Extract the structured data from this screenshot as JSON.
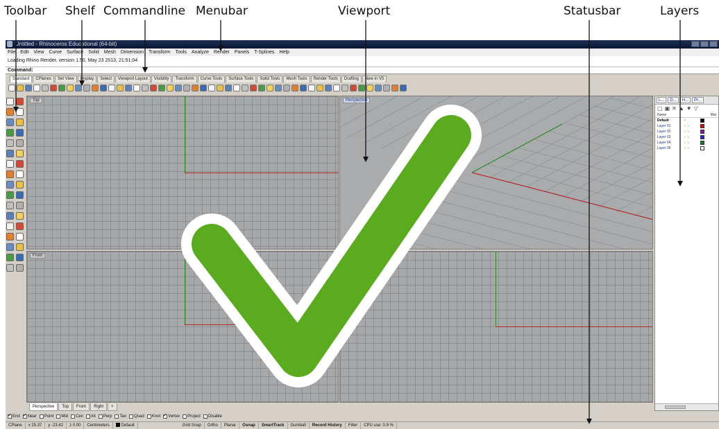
{
  "callouts": {
    "toolbar": "Toolbar",
    "shelf": "Shelf",
    "commandline": "Commandline",
    "menubar": "Menubar",
    "viewport": "Viewport",
    "statusbar": "Statusbar",
    "layers": "Layers"
  },
  "app": {
    "title": "Untitled - Rhinoceros Educational (64-bit)",
    "menu": [
      "File",
      "Edit",
      "View",
      "Curve",
      "Surface",
      "Solid",
      "Mesh",
      "Dimension",
      "Transform",
      "Tools",
      "Analyze",
      "Render",
      "Panels",
      "T-Splines",
      "Help"
    ],
    "history_line": "Loading Rhino Render, version 1.50, May 23 2013, 21:51:04",
    "command_prompt": "Command:",
    "toolbar_tabs": [
      "Standard",
      "CPlanes",
      "Set View",
      "Display",
      "Select",
      "Viewport Layout",
      "Visibility",
      "Transform",
      "Curve Tools",
      "Surface Tools",
      "Solid Tools",
      "Mesh Tools",
      "Render Tools",
      "Drafting",
      "New in V5"
    ],
    "active_tab": "Standard"
  },
  "viewports": {
    "top": "Top",
    "perspective": "Perspective",
    "front": "Front",
    "right": "Right"
  },
  "viewport_tabs": [
    "Perspective",
    "Top",
    "Front",
    "Right",
    "+"
  ],
  "osnaps": [
    {
      "label": "End",
      "checked": true
    },
    {
      "label": "Near",
      "checked": true
    },
    {
      "label": "Point",
      "checked": false
    },
    {
      "label": "Mid",
      "checked": false
    },
    {
      "label": "Cen",
      "checked": false
    },
    {
      "label": "Int",
      "checked": false
    },
    {
      "label": "Perp",
      "checked": false
    },
    {
      "label": "Tan",
      "checked": false
    },
    {
      "label": "Quad",
      "checked": false
    },
    {
      "label": "Knot",
      "checked": false
    },
    {
      "label": "Vertex",
      "checked": true
    },
    {
      "label": "Project",
      "checked": false
    },
    {
      "label": "Disable",
      "checked": false
    }
  ],
  "statusbar": {
    "cplane": "CPlane",
    "x": "x 25.37",
    "y": "y -23.42",
    "z": "z 0.00",
    "units": "Centimeters",
    "layer": "Default",
    "grid_snap": "Grid Snap",
    "ortho": "Ortho",
    "planar": "Planar",
    "osnap": "Osnap",
    "smarttrack": "SmartTrack",
    "gumball": "Gumball",
    "record_history": "Record History",
    "filter": "Filter",
    "cpu": "CPU use: 0.9 %"
  },
  "layers_panel": {
    "tabs": [
      "L...",
      "D...",
      "H...",
      "Pr..."
    ],
    "header_name": "Name",
    "header_material": "Mat",
    "rows": [
      {
        "name": "Default",
        "current": true,
        "color": "#000000"
      },
      {
        "name": "Layer 01",
        "current": false,
        "color": "#d01010"
      },
      {
        "name": "Layer 02",
        "current": false,
        "color": "#8a1a9a"
      },
      {
        "name": "Layer 03",
        "current": false,
        "color": "#1a2fbf"
      },
      {
        "name": "Layer 04",
        "current": false,
        "color": "#1a7a2a"
      },
      {
        "name": "Layer 05",
        "current": false,
        "color": "#ffffff"
      }
    ]
  },
  "overlay": {
    "icon": "checkmark-icon",
    "color": "#5aab1f"
  }
}
